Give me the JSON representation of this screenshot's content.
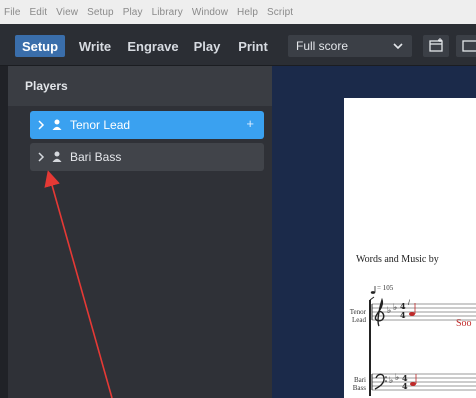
{
  "menu": [
    "File",
    "Edit",
    "View",
    "Setup",
    "Play",
    "Library",
    "Window",
    "Help",
    "Script"
  ],
  "modes": [
    "Setup",
    "Write",
    "Engrave",
    "Play",
    "Print"
  ],
  "active_mode": "Setup",
  "layout_selector": {
    "value": "Full score"
  },
  "players_panel": {
    "title": "Players",
    "players": [
      {
        "name": "Tenor Lead",
        "selected": true,
        "add_symbol": "+"
      },
      {
        "name": "Bari Bass",
        "selected": false
      }
    ]
  },
  "score": {
    "credit_text": "Words and Music by",
    "tempo_text": "= 105",
    "staves": [
      {
        "line1": "Tenor",
        "line2": "Lead"
      },
      {
        "line1": "Bari",
        "line2": "Bass"
      }
    ],
    "lyric": "Soo"
  },
  "colors": {
    "accent": "#3a6eab",
    "selected_player": "#3aa1f0",
    "annotation_arrow": "#e53935",
    "score_background": "#1b2a4a"
  }
}
